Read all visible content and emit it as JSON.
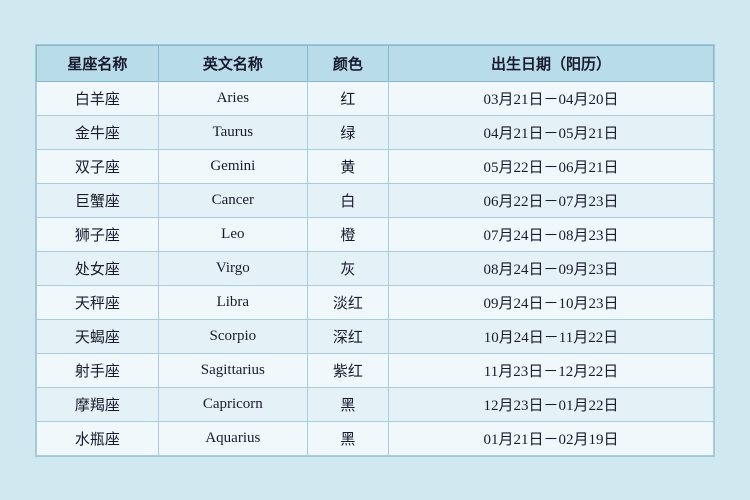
{
  "table": {
    "headers": {
      "col1": "星座名称",
      "col2": "英文名称",
      "col3": "颜色",
      "col4": "出生日期（阳历）"
    },
    "rows": [
      {
        "chinese": "白羊座",
        "english": "Aries",
        "color": "红",
        "date": "03月21日－04月20日"
      },
      {
        "chinese": "金牛座",
        "english": "Taurus",
        "color": "绿",
        "date": "04月21日－05月21日"
      },
      {
        "chinese": "双子座",
        "english": "Gemini",
        "color": "黄",
        "date": "05月22日－06月21日"
      },
      {
        "chinese": "巨蟹座",
        "english": "Cancer",
        "color": "白",
        "date": "06月22日－07月23日"
      },
      {
        "chinese": "狮子座",
        "english": "Leo",
        "color": "橙",
        "date": "07月24日－08月23日"
      },
      {
        "chinese": "处女座",
        "english": "Virgo",
        "color": "灰",
        "date": "08月24日－09月23日"
      },
      {
        "chinese": "天秤座",
        "english": "Libra",
        "color": "淡红",
        "date": "09月24日－10月23日"
      },
      {
        "chinese": "天蝎座",
        "english": "Scorpio",
        "color": "深红",
        "date": "10月24日－11月22日"
      },
      {
        "chinese": "射手座",
        "english": "Sagittarius",
        "color": "紫红",
        "date": "11月23日－12月22日"
      },
      {
        "chinese": "摩羯座",
        "english": "Capricorn",
        "color": "黑",
        "date": "12月23日－01月22日"
      },
      {
        "chinese": "水瓶座",
        "english": "Aquarius",
        "color": "黑",
        "date": "01月21日－02月19日"
      }
    ]
  }
}
